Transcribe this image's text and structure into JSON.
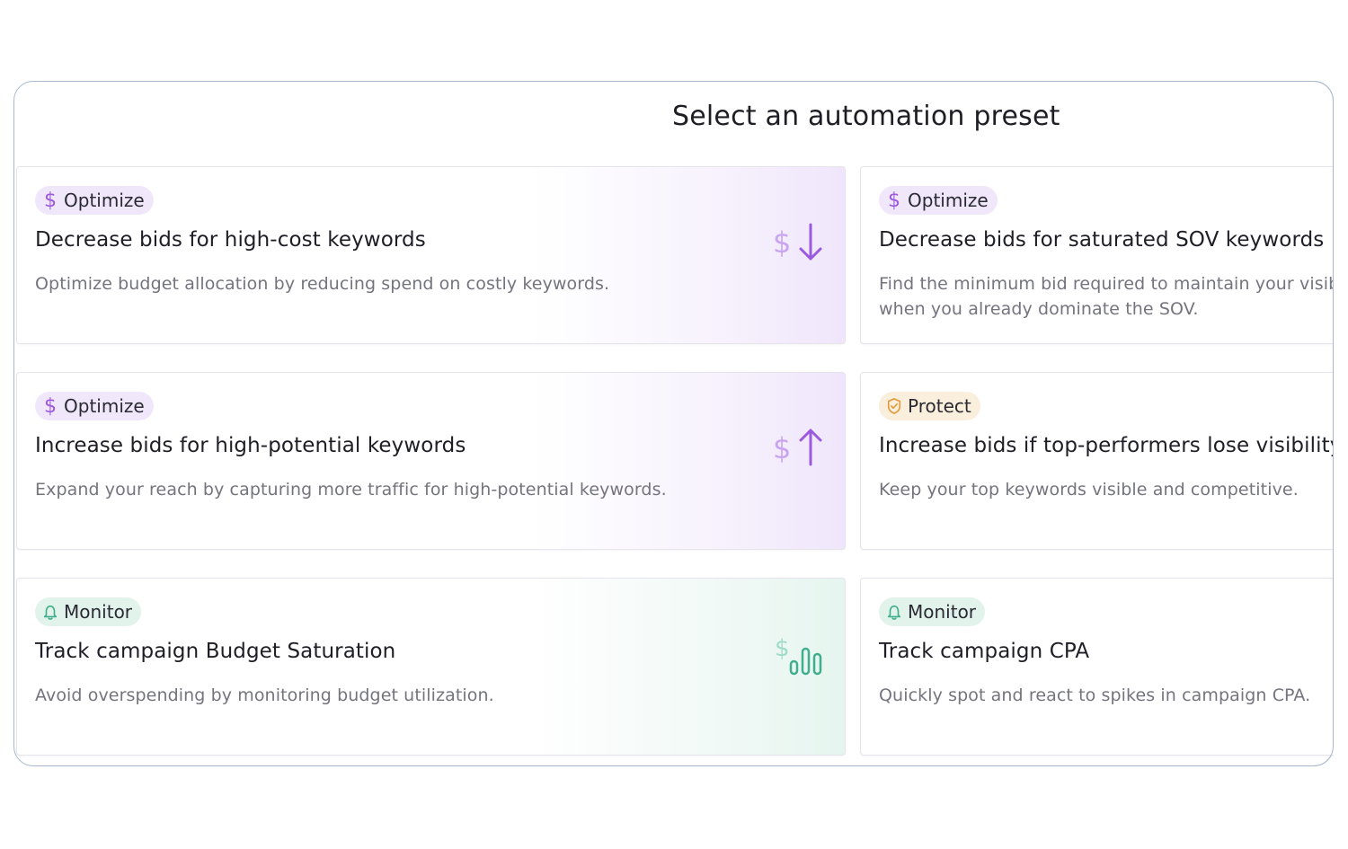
{
  "dialog": {
    "title": "Select an automation preset"
  },
  "colors": {
    "optimize_accent": "#9b59e0",
    "protect_accent": "#e39a3b",
    "monitor_accent": "#3fae8c",
    "panel_border": "#a9b8cf"
  },
  "presets": [
    {
      "category": "Optimize",
      "category_icon": "dollar-icon",
      "title": "Decrease bids for high-cost keywords",
      "description": "Optimize budget allocation by reducing spend on costly keywords.",
      "illustration": "dollar-arrow-down-icon"
    },
    {
      "category": "Optimize",
      "category_icon": "dollar-icon",
      "title": "Decrease bids for saturated SOV keywords",
      "description": "Find the minimum bid required to maintain your visibility when you already dominate the SOV."
    },
    {
      "category": "Optimize",
      "category_icon": "dollar-icon",
      "title": "Increase bids for high-potential keywords",
      "description": "Expand your reach by capturing more traffic for high-potential keywords.",
      "illustration": "dollar-arrow-up-icon"
    },
    {
      "category": "Protect",
      "category_icon": "shield-check-icon",
      "title": "Increase bids if top-performers lose visibility",
      "description": "Keep your top keywords visible and competitive."
    },
    {
      "category": "Monitor",
      "category_icon": "bell-icon",
      "title": "Track campaign Budget Saturation",
      "description": "Avoid overspending by monitoring budget utilization.",
      "illustration": "dollar-bar-chart-icon"
    },
    {
      "category": "Monitor",
      "category_icon": "bell-icon",
      "title": "Track campaign CPA",
      "description": "Quickly spot and react to spikes in campaign CPA."
    }
  ]
}
